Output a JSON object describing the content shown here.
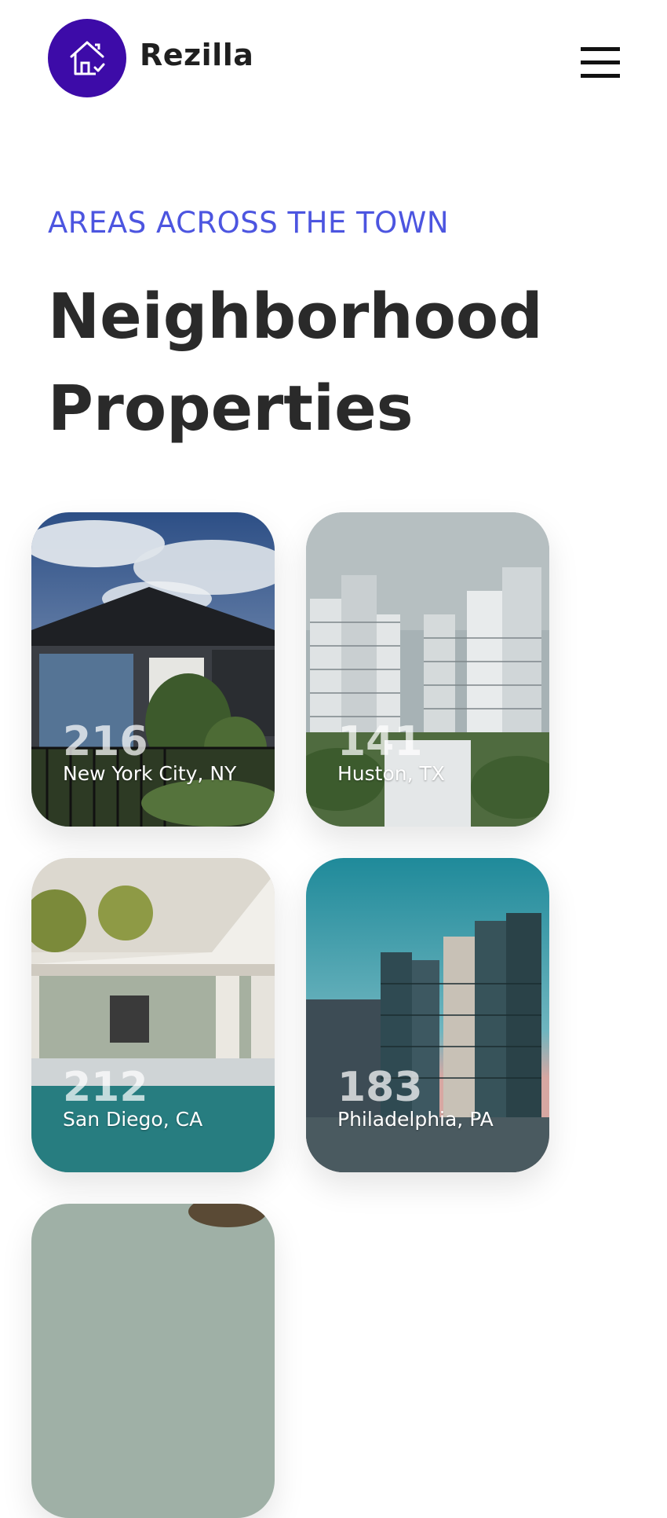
{
  "header": {
    "brand": "Rezilla",
    "logo_icon": "house-check-icon",
    "menu_icon": "hamburger-menu-icon",
    "brand_color": "#3d0ba8"
  },
  "section": {
    "eyebrow": "AREAS ACROSS THE TOWN",
    "title": "Neighborhood Properties",
    "accent_color": "#4c55e0"
  },
  "neighborhoods": [
    {
      "count": "216",
      "city": "New York City, NY"
    },
    {
      "count": "141",
      "city": "Huston, TX"
    },
    {
      "count": "212",
      "city": "San Diego, CA"
    },
    {
      "count": "183",
      "city": "Philadelphia, PA"
    }
  ]
}
